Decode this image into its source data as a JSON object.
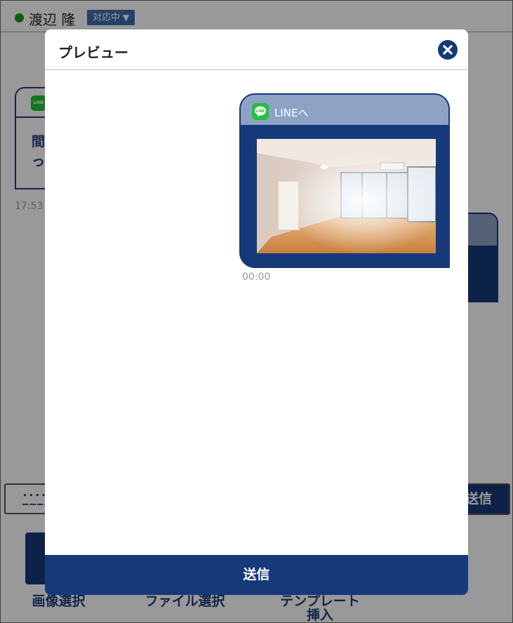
{
  "header": {
    "user_name": "渡辺 隆",
    "status_label": "対応中",
    "status_arrow": "▼",
    "status_dot_color": "#1a9a1a"
  },
  "background": {
    "card_text_line1": "間",
    "card_text_line2": "っ",
    "card_time": "17:53",
    "send_label": "送信"
  },
  "toolbar": {
    "image_select": "画像選択",
    "file_select": "ファイル選択",
    "template_insert": "テンプレート挿入"
  },
  "modal": {
    "title": "プレビュー",
    "bubble": {
      "destination": "LINEへ",
      "time": "00:00",
      "image": "room-photo"
    },
    "send_label": "送信"
  },
  "colors": {
    "brand_navy": "#16397a",
    "bubble_header": "#8ea2c6",
    "line_green": "#23c13a"
  },
  "icons": [
    "close-icon",
    "line-icon",
    "keyboard-icon",
    "status-dot"
  ]
}
